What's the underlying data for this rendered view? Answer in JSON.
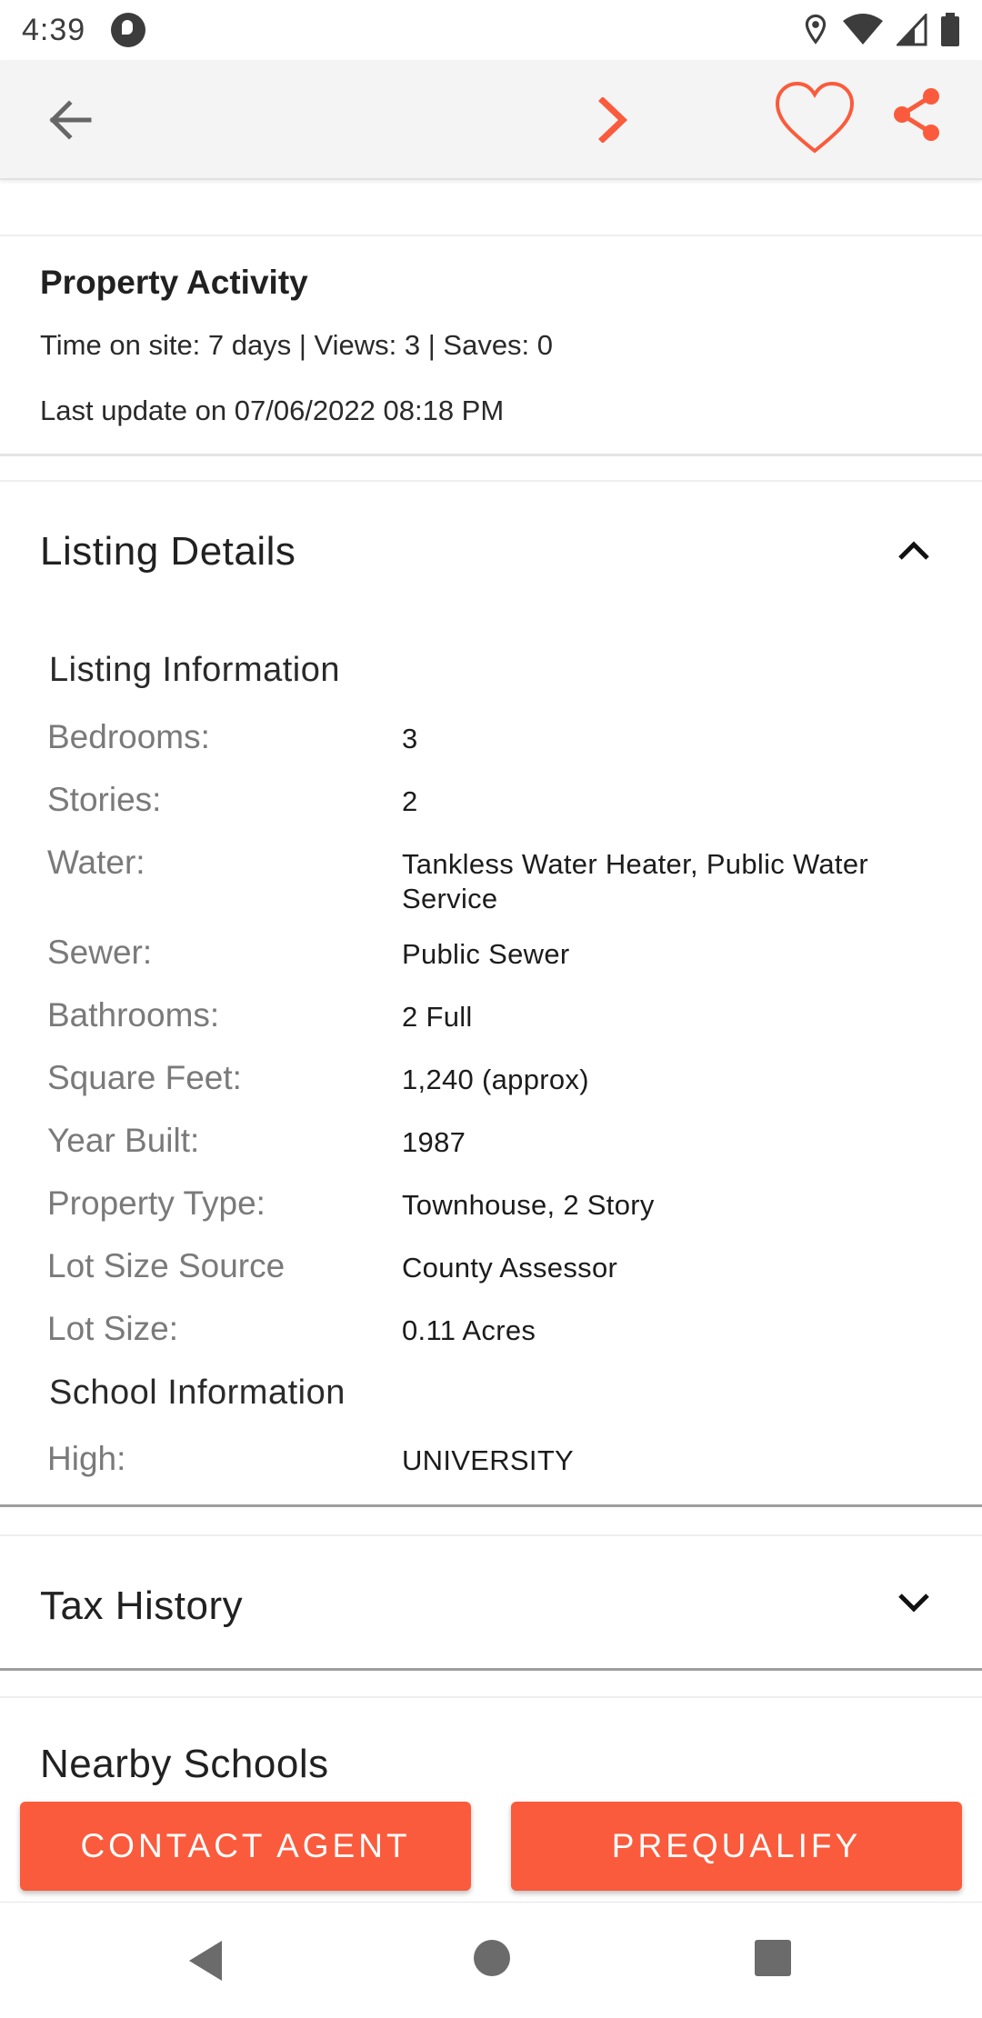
{
  "status_bar": {
    "time": "4:39",
    "icons": [
      "app-notification-icon",
      "location-icon",
      "wifi-icon",
      "signal-icon",
      "battery-icon"
    ]
  },
  "app_bar": {
    "icons": [
      "arrow-back-icon",
      "chevron-right-icon",
      "heart-outline-icon",
      "share-icon"
    ],
    "accent_color": "#fa5b3c"
  },
  "activity": {
    "title": "Property Activity",
    "stats_line": "Time on site: 7 days | Views: 3  | Saves: 0",
    "update_line": "Last update on 07/06/2022 08:18 PM"
  },
  "listing_details": {
    "title": "Listing Details",
    "expanded": true,
    "listing_info_heading": "Listing Information",
    "rows": [
      {
        "label": "Bedrooms:",
        "value": "3"
      },
      {
        "label": "Stories:",
        "value": "2"
      },
      {
        "label": "Water:",
        "value": "Tankless Water Heater, Public Water Service"
      },
      {
        "label": "Sewer:",
        "value": "Public Sewer"
      },
      {
        "label": "Bathrooms:",
        "value": "2 Full"
      },
      {
        "label": "Square Feet:",
        "value": "1,240 (approx)"
      },
      {
        "label": "Year Built:",
        "value": "1987"
      },
      {
        "label": "Property Type:",
        "value": "Townhouse, 2 Story"
      },
      {
        "label": "Lot Size Source",
        "value": "County Assessor"
      },
      {
        "label": "Lot Size:",
        "value": "0.11 Acres"
      }
    ],
    "school_info_heading": "School Information",
    "school_rows": [
      {
        "label": "High:",
        "value": "UNIVERSITY"
      }
    ]
  },
  "tax_history": {
    "title": "Tax History",
    "expanded": false
  },
  "nearby_schools": {
    "title": "Nearby Schools"
  },
  "actions": {
    "contact_label": "CONTACT AGENT",
    "prequalify_label": "PREQUALIFY"
  },
  "nav_bar": {
    "icons": [
      "nav-back-icon",
      "nav-home-icon",
      "nav-recents-icon"
    ]
  }
}
